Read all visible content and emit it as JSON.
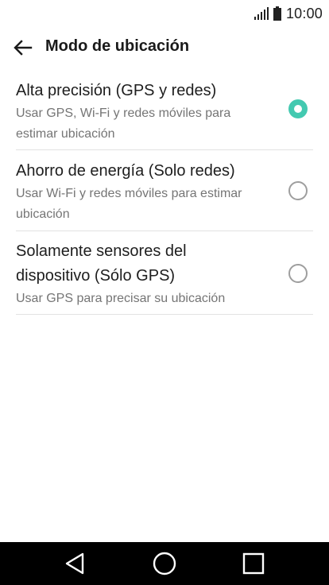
{
  "status_bar": {
    "time": "10:00",
    "signal_icon": "signal-bars-icon",
    "battery_icon": "battery-icon"
  },
  "app_bar": {
    "back_icon": "back-arrow-icon",
    "title": "Modo de ubicación"
  },
  "options": [
    {
      "title": "Alta precisión (GPS y redes)",
      "description": "Usar GPS, Wi-Fi y redes móviles para estimar ubicación",
      "selected": true
    },
    {
      "title": "Ahorro de energía (Solo redes)",
      "description": "Usar Wi-Fi y redes móviles para estimar ubicación",
      "selected": false
    },
    {
      "title": "Solamente sensores del dispositivo (Sólo GPS)",
      "description": "Usar GPS para precisar su ubicación",
      "selected": false
    }
  ],
  "nav_bar": {
    "back_icon": "nav-back-triangle-icon",
    "home_icon": "nav-home-circle-icon",
    "recents_icon": "nav-recents-square-icon"
  },
  "colors": {
    "accent": "#43c9b0",
    "nav_background": "#000000",
    "secondary_text": "#757575"
  }
}
